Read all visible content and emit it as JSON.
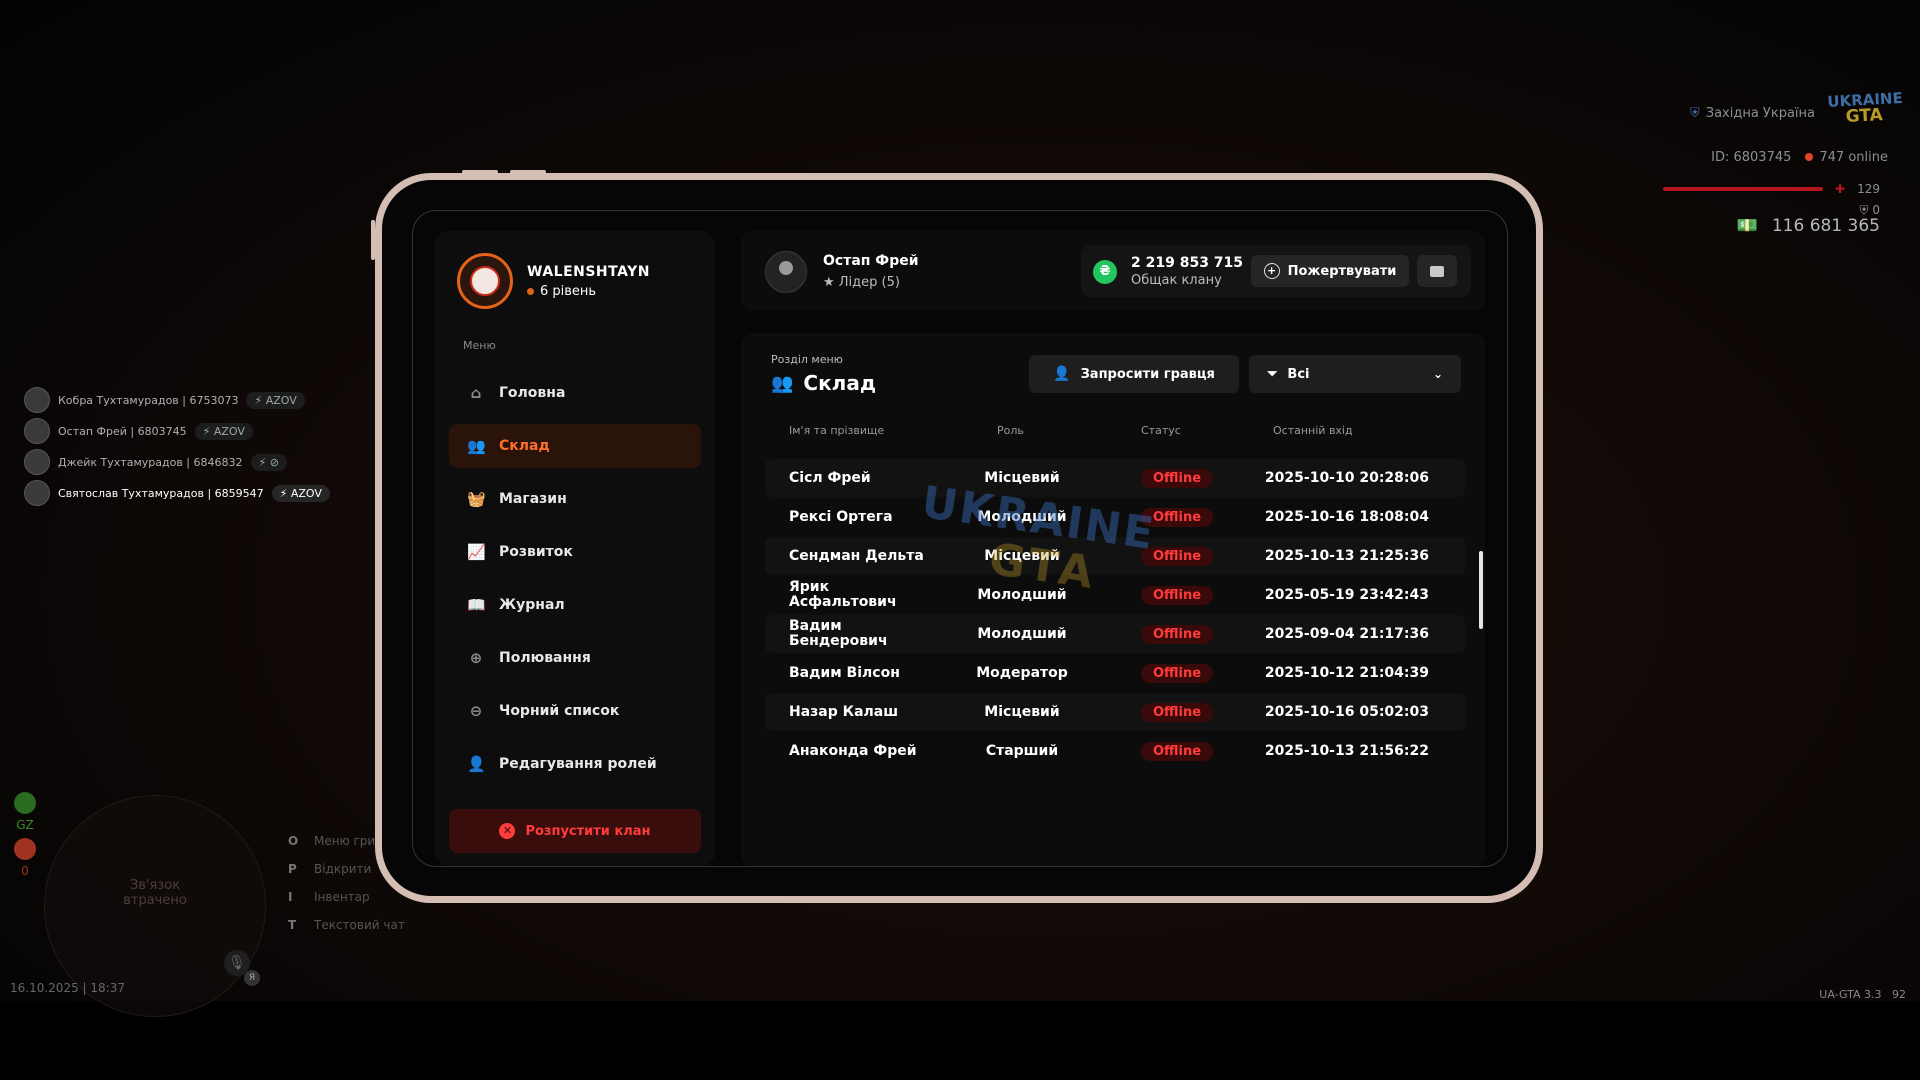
{
  "hud": {
    "server_name": "Західна Україна",
    "logo_top": "UKRAINE",
    "logo_bottom": "GTA",
    "player_id": "ID: 6803745",
    "online": "747 online",
    "health": "129",
    "armor": "0",
    "money": "116 681 365",
    "timestamp": "16.10.2025 | 18:37",
    "version": "UA-GTA 3.3",
    "version_extra": "92",
    "minimap_status": "Зв'язок втрачено",
    "gz_label": "GZ",
    "wanted_count": "0",
    "mic_badge": "Я"
  },
  "players": [
    {
      "name": "Кобра Тухтамурадов | 6753073",
      "tag": "⚡ AZOV",
      "active": false
    },
    {
      "name": "Остап Фрей | 6803745",
      "tag": "⚡ AZOV",
      "active": false
    },
    {
      "name": "Джейк Тухтамурадов | 6846832",
      "tag": "",
      "active": false
    },
    {
      "name": "Святослав Тухтамурадов | 6859547",
      "tag": "⚡ AZOV",
      "active": true
    }
  ],
  "keyhints": [
    {
      "key": "O",
      "label": "Меню гри"
    },
    {
      "key": "P",
      "label": "Відкрити"
    },
    {
      "key": "I",
      "label": "Інвентар"
    },
    {
      "key": "T",
      "label": "Текстовий чат"
    }
  ],
  "clan": {
    "name": "WALENSHTAYN",
    "level": "6 рівень",
    "menu_caption": "Меню",
    "menu": [
      {
        "label": "Головна",
        "icon": "home-icon",
        "glyph": "⌂",
        "active": false
      },
      {
        "label": "Склад",
        "icon": "users-icon",
        "glyph": "👥",
        "active": true
      },
      {
        "label": "Магазин",
        "icon": "basket-icon",
        "glyph": "🧺",
        "active": false
      },
      {
        "label": "Розвиток",
        "icon": "chart-icon",
        "glyph": "📈",
        "active": false
      },
      {
        "label": "Журнал",
        "icon": "book-icon",
        "glyph": "📖",
        "active": false
      },
      {
        "label": "Полювання",
        "icon": "crosshair-icon",
        "glyph": "⊕",
        "active": false
      },
      {
        "label": "Чорний список",
        "icon": "block-icon",
        "glyph": "⊖",
        "active": false
      },
      {
        "label": "Редагування ролей",
        "icon": "user-cog-icon",
        "glyph": "👤",
        "active": false
      }
    ],
    "disband_label": "Розпустити клан"
  },
  "leader": {
    "name": "Остап Фрей",
    "role": "★ Лідер (5)"
  },
  "bank": {
    "amount": "2 219 853 715",
    "caption": "Общак клану",
    "donate_label": "Пожертвувати"
  },
  "section": {
    "caption": "Розділ меню",
    "title": "Склад",
    "invite_label": "Запросити гравця",
    "filter_value": "Всі"
  },
  "table": {
    "headers": [
      "Ім'я та прізвище",
      "Роль",
      "Статус",
      "Останній вхід"
    ],
    "rows": [
      {
        "name": "Сісл Фрей",
        "role": "Місцевий",
        "status": "Offline",
        "last": "2025-10-10 20:28:06"
      },
      {
        "name": "Рексі Ортега",
        "role": "Молодший",
        "status": "Offline",
        "last": "2025-10-16 18:08:04"
      },
      {
        "name": "Сендман Дельта",
        "role": "Місцевий",
        "status": "Offline",
        "last": "2025-10-13 21:25:36"
      },
      {
        "name": "Ярик Асфальтович",
        "role": "Молодший",
        "status": "Offline",
        "last": "2025-05-19 23:42:43"
      },
      {
        "name": "Вадим Бендерович",
        "role": "Молодший",
        "status": "Offline",
        "last": "2025-09-04 21:17:36"
      },
      {
        "name": "Вадим Вілсон",
        "role": "Модератор",
        "status": "Offline",
        "last": "2025-10-12 21:04:39"
      },
      {
        "name": "Назар Калаш",
        "role": "Місцевий",
        "status": "Offline",
        "last": "2025-10-16 05:02:03"
      },
      {
        "name": "Анаконда Фрей",
        "role": "Старший",
        "status": "Offline",
        "last": "2025-10-13 21:56:22"
      }
    ]
  },
  "colors": {
    "accent": "#ff6e2a",
    "offline": "#ff3b3b",
    "coin": "#22c55e"
  }
}
